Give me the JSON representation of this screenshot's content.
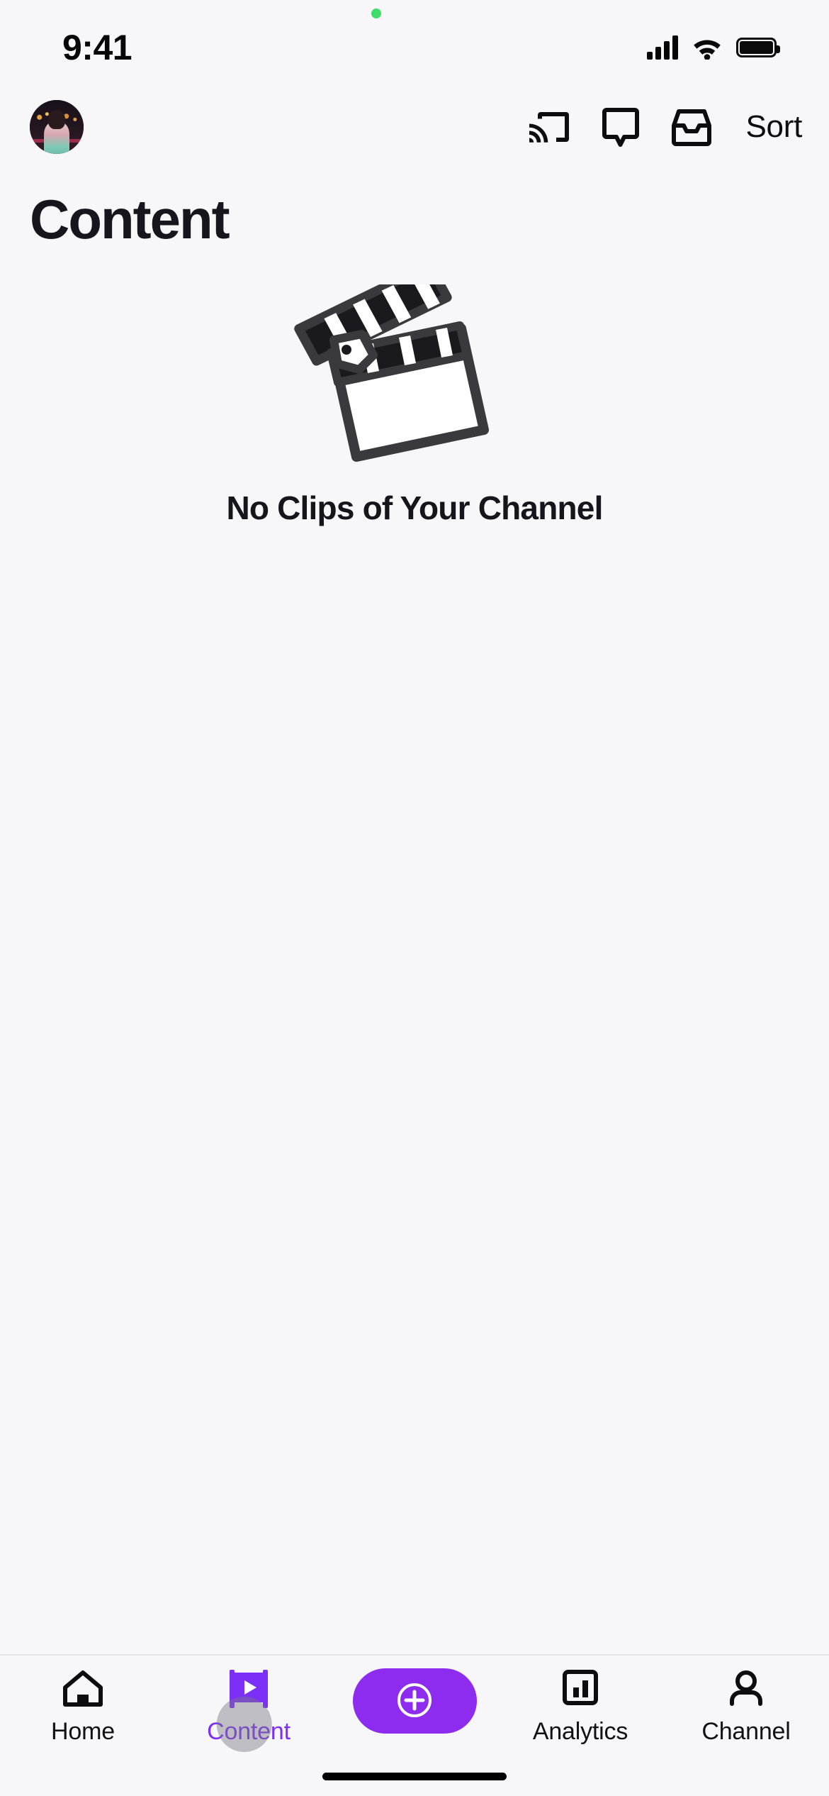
{
  "status_bar": {
    "time": "9:41",
    "green_dot": "recording-indicator",
    "cellular_icon": "cellular-bars-icon",
    "wifi_icon": "wifi-icon",
    "battery_icon": "battery-full-icon"
  },
  "header": {
    "avatar": "user-avatar",
    "cast_icon": "cast-icon",
    "comments_icon": "comment-bubble-icon",
    "inbox_icon": "inbox-icon",
    "sort_label": "Sort"
  },
  "page": {
    "title": "Content"
  },
  "empty_state": {
    "illustration": "clapperboard-icon",
    "message": "No Clips of Your Channel"
  },
  "tabbar": {
    "items": [
      {
        "label": "Home",
        "icon": "home-icon",
        "active": false
      },
      {
        "label": "Content",
        "icon": "clip-play-icon",
        "active": true
      },
      {
        "label": "Analytics",
        "icon": "bar-chart-icon",
        "active": false
      },
      {
        "label": "Channel",
        "icon": "person-icon",
        "active": false
      }
    ],
    "create_button": {
      "icon": "plus-circle-icon",
      "label": ""
    }
  },
  "colors": {
    "background": "#f7f6f9",
    "accent_purple": "#8d2bef",
    "active_tab_text": "#7b2ff7",
    "text_primary": "#15151b",
    "status_green": "#3ddc6b"
  }
}
